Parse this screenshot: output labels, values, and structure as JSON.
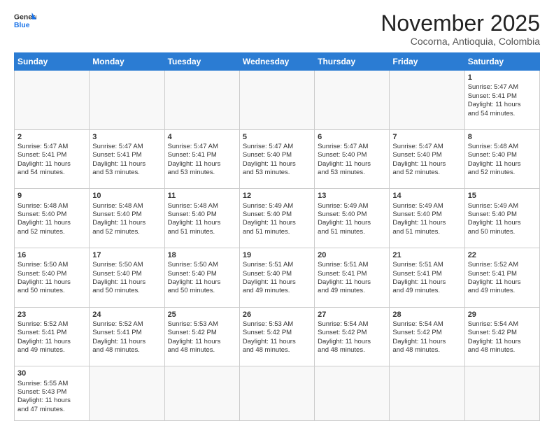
{
  "header": {
    "logo_line1": "General",
    "logo_line2": "Blue",
    "month_title": "November 2025",
    "location": "Cocorna, Antioquia, Colombia"
  },
  "days_of_week": [
    "Sunday",
    "Monday",
    "Tuesday",
    "Wednesday",
    "Thursday",
    "Friday",
    "Saturday"
  ],
  "weeks": [
    [
      {
        "day": "",
        "info": ""
      },
      {
        "day": "",
        "info": ""
      },
      {
        "day": "",
        "info": ""
      },
      {
        "day": "",
        "info": ""
      },
      {
        "day": "",
        "info": ""
      },
      {
        "day": "",
        "info": ""
      },
      {
        "day": "1",
        "info": "Sunrise: 5:47 AM\nSunset: 5:41 PM\nDaylight: 11 hours\nand 54 minutes."
      }
    ],
    [
      {
        "day": "2",
        "info": "Sunrise: 5:47 AM\nSunset: 5:41 PM\nDaylight: 11 hours\nand 54 minutes."
      },
      {
        "day": "3",
        "info": "Sunrise: 5:47 AM\nSunset: 5:41 PM\nDaylight: 11 hours\nand 53 minutes."
      },
      {
        "day": "4",
        "info": "Sunrise: 5:47 AM\nSunset: 5:41 PM\nDaylight: 11 hours\nand 53 minutes."
      },
      {
        "day": "5",
        "info": "Sunrise: 5:47 AM\nSunset: 5:40 PM\nDaylight: 11 hours\nand 53 minutes."
      },
      {
        "day": "6",
        "info": "Sunrise: 5:47 AM\nSunset: 5:40 PM\nDaylight: 11 hours\nand 53 minutes."
      },
      {
        "day": "7",
        "info": "Sunrise: 5:47 AM\nSunset: 5:40 PM\nDaylight: 11 hours\nand 52 minutes."
      },
      {
        "day": "8",
        "info": "Sunrise: 5:48 AM\nSunset: 5:40 PM\nDaylight: 11 hours\nand 52 minutes."
      }
    ],
    [
      {
        "day": "9",
        "info": "Sunrise: 5:48 AM\nSunset: 5:40 PM\nDaylight: 11 hours\nand 52 minutes."
      },
      {
        "day": "10",
        "info": "Sunrise: 5:48 AM\nSunset: 5:40 PM\nDaylight: 11 hours\nand 52 minutes."
      },
      {
        "day": "11",
        "info": "Sunrise: 5:48 AM\nSunset: 5:40 PM\nDaylight: 11 hours\nand 51 minutes."
      },
      {
        "day": "12",
        "info": "Sunrise: 5:49 AM\nSunset: 5:40 PM\nDaylight: 11 hours\nand 51 minutes."
      },
      {
        "day": "13",
        "info": "Sunrise: 5:49 AM\nSunset: 5:40 PM\nDaylight: 11 hours\nand 51 minutes."
      },
      {
        "day": "14",
        "info": "Sunrise: 5:49 AM\nSunset: 5:40 PM\nDaylight: 11 hours\nand 51 minutes."
      },
      {
        "day": "15",
        "info": "Sunrise: 5:49 AM\nSunset: 5:40 PM\nDaylight: 11 hours\nand 50 minutes."
      }
    ],
    [
      {
        "day": "16",
        "info": "Sunrise: 5:50 AM\nSunset: 5:40 PM\nDaylight: 11 hours\nand 50 minutes."
      },
      {
        "day": "17",
        "info": "Sunrise: 5:50 AM\nSunset: 5:40 PM\nDaylight: 11 hours\nand 50 minutes."
      },
      {
        "day": "18",
        "info": "Sunrise: 5:50 AM\nSunset: 5:40 PM\nDaylight: 11 hours\nand 50 minutes."
      },
      {
        "day": "19",
        "info": "Sunrise: 5:51 AM\nSunset: 5:40 PM\nDaylight: 11 hours\nand 49 minutes."
      },
      {
        "day": "20",
        "info": "Sunrise: 5:51 AM\nSunset: 5:41 PM\nDaylight: 11 hours\nand 49 minutes."
      },
      {
        "day": "21",
        "info": "Sunrise: 5:51 AM\nSunset: 5:41 PM\nDaylight: 11 hours\nand 49 minutes."
      },
      {
        "day": "22",
        "info": "Sunrise: 5:52 AM\nSunset: 5:41 PM\nDaylight: 11 hours\nand 49 minutes."
      }
    ],
    [
      {
        "day": "23",
        "info": "Sunrise: 5:52 AM\nSunset: 5:41 PM\nDaylight: 11 hours\nand 49 minutes."
      },
      {
        "day": "24",
        "info": "Sunrise: 5:52 AM\nSunset: 5:41 PM\nDaylight: 11 hours\nand 48 minutes."
      },
      {
        "day": "25",
        "info": "Sunrise: 5:53 AM\nSunset: 5:42 PM\nDaylight: 11 hours\nand 48 minutes."
      },
      {
        "day": "26",
        "info": "Sunrise: 5:53 AM\nSunset: 5:42 PM\nDaylight: 11 hours\nand 48 minutes."
      },
      {
        "day": "27",
        "info": "Sunrise: 5:54 AM\nSunset: 5:42 PM\nDaylight: 11 hours\nand 48 minutes."
      },
      {
        "day": "28",
        "info": "Sunrise: 5:54 AM\nSunset: 5:42 PM\nDaylight: 11 hours\nand 48 minutes."
      },
      {
        "day": "29",
        "info": "Sunrise: 5:54 AM\nSunset: 5:42 PM\nDaylight: 11 hours\nand 48 minutes."
      }
    ],
    [
      {
        "day": "30",
        "info": "Sunrise: 5:55 AM\nSunset: 5:43 PM\nDaylight: 11 hours\nand 47 minutes."
      },
      {
        "day": "",
        "info": ""
      },
      {
        "day": "",
        "info": ""
      },
      {
        "day": "",
        "info": ""
      },
      {
        "day": "",
        "info": ""
      },
      {
        "day": "",
        "info": ""
      },
      {
        "day": "",
        "info": ""
      }
    ]
  ]
}
